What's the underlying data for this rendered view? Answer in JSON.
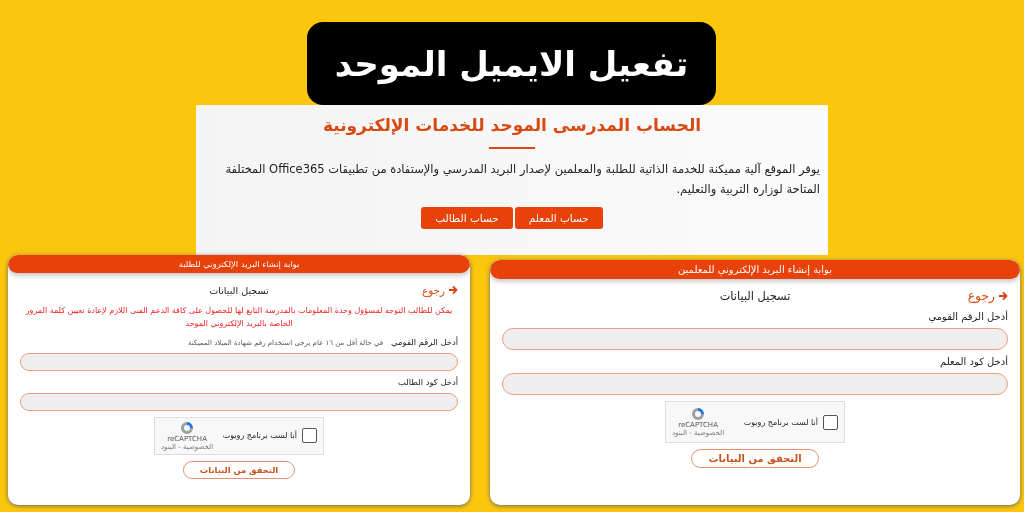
{
  "title": "تفعيل الايميل الموحد",
  "intro": {
    "heading": "الحساب المدرسى الموحد للخدمات الإلكترونية",
    "paragraph": "يوفر الموقع آلية مميكنة للخدمة الذاتية للطلبة والمعلمين لإصدار البريد المدرسي والإستفادة من تطبيقات Office365 المختلفة المتاحة لوزارة التربية والتعليم.",
    "buttons": [
      "حساب المعلم",
      "حساب الطالب"
    ]
  },
  "portals": [
    {
      "header": "بوابة إنشاء البريد الإلكتروني للمعلمين",
      "back": "رجوع",
      "section_title": "تسجيل البيانات",
      "fields": [
        {
          "label": "أدخل الرقم القومي"
        },
        {
          "label": "أدخل كود المعلم"
        }
      ],
      "captcha": {
        "label": "أنا لست برنامج روبوت",
        "checked": false,
        "brand": "reCAPTCHA",
        "terms": "الخصوصية - البنود"
      },
      "submit": "التحقق من البيانات"
    },
    {
      "header": "بوابة إنشاء البريد الإلكتروني للطلبة",
      "back": "رجوع",
      "section_title": "تسجيل البيانات",
      "notice": "يمكن للطالب التوجه لمسؤول وحدة المعلومات بالمدرسة التابع لها للحصول على كافة الدعم الفنى اللازم لإعادة تعيين كلمة المرور الخاصة بالبريد الإلكتروني الموحد",
      "fields": [
        {
          "label": "أدخل الرقم القومي",
          "hint": "في حالة أقل من ١٦ عام يرجى استخدام رقم شهادة الميلاد المميكنة"
        },
        {
          "label": "أدخل كود الطالب"
        }
      ],
      "captcha": {
        "label": "أنا لست برنامج روبوت",
        "checked": false,
        "brand": "reCAPTCHA",
        "terms": "الخصوصية - البنود"
      },
      "submit": "التحقق من البيانات"
    }
  ]
}
